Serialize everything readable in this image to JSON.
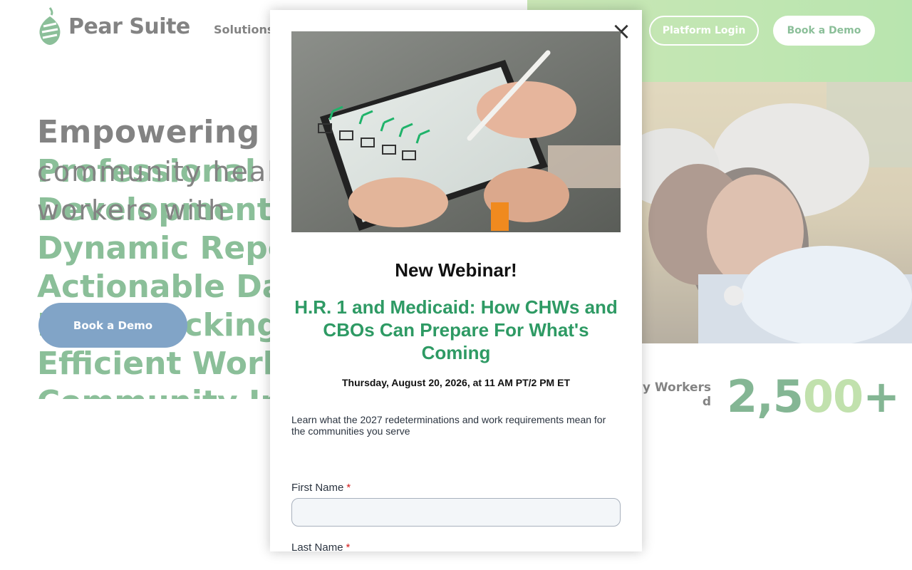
{
  "header": {
    "brand": "Pear Suite",
    "nav_solutions": "Solutions",
    "platform_login": "Platform Login",
    "book_demo": "Book a Demo"
  },
  "hero": {
    "title": "Empowering",
    "subtitle_line1": "community health",
    "subtitle_line2": "workers with",
    "rotating_items": [
      "Professional",
      "Development",
      "Dynamic Reports",
      "Actionable Data",
      "Easy Tracking",
      "Efficient Workflows",
      "Community Impact"
    ],
    "cta": "Book a Demo",
    "stat_label_line1": "y Workers",
    "stat_label_line2": "d",
    "stat_value_dark": "2,5",
    "stat_value_light": "00",
    "stat_value_plus": "+"
  },
  "modal": {
    "close_icon": "×",
    "kicker": "New Webinar!",
    "headline": "H.R. 1 and Medicaid: How CHWs and CBOs Can Prepare For What's Coming",
    "date": "Thursday, August 20, 2026, at 11 AM PT/2 PM ET",
    "description": "Learn what the 2027 redeterminations and work requirements mean for the communities you serve",
    "first_name_label": "First Name",
    "last_name_label": "Last Name",
    "required_marker": "*",
    "first_name_value": "",
    "last_name_value": ""
  },
  "colors": {
    "brand_green": "#2c8a46",
    "headline_green": "#2e9a64",
    "cta_blue": "#1b5a9a",
    "header_green": "#8fd270"
  },
  "icons": {
    "close": "close-icon",
    "logo": "pear-logo-icon"
  }
}
